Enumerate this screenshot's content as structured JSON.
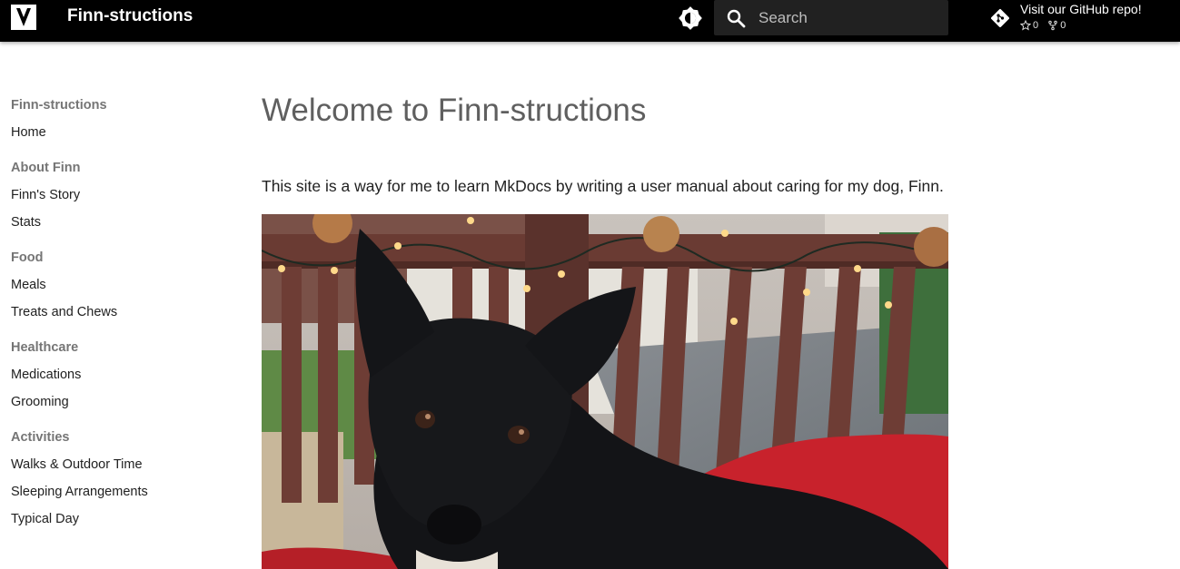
{
  "header": {
    "site_title": "Finn-structions",
    "logo_icon": "logo-icon",
    "palette_icon": "brightness-icon",
    "search": {
      "placeholder": "Search",
      "value": ""
    },
    "repo": {
      "name": "Visit our GitHub repo!",
      "stars": "0",
      "forks": "0"
    }
  },
  "sidebar": {
    "sections": [
      {
        "title": "Finn-structions",
        "items": [
          "Home"
        ]
      },
      {
        "title": "About Finn",
        "items": [
          "Finn's Story",
          "Stats"
        ]
      },
      {
        "title": "Food",
        "items": [
          "Meals",
          "Treats and Chews"
        ]
      },
      {
        "title": "Healthcare",
        "items": [
          "Medications",
          "Grooming"
        ]
      },
      {
        "title": "Activities",
        "items": [
          "Walks & Outdoor Time",
          "Sleeping Arrangements",
          "Typical Day"
        ]
      }
    ]
  },
  "main": {
    "title": "Welcome to Finn-structions",
    "intro": "This site is a way for me to learn MkDocs by writing a user manual about caring for my dog, Finn."
  },
  "colors": {
    "header_bg": "#000000",
    "search_bg": "#212121",
    "section_title": "#757575",
    "text": "#212121"
  }
}
